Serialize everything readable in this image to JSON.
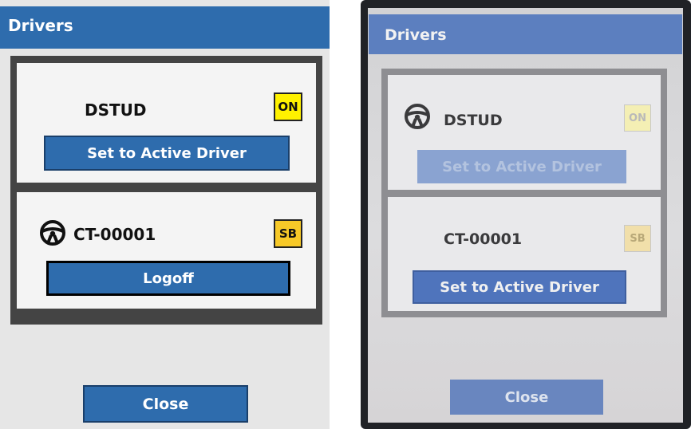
{
  "left_screen": {
    "title": "Drivers",
    "drivers": [
      {
        "name": "DSTUD",
        "status": "ON",
        "status_color": "#fff200",
        "is_active": false,
        "button_label": "Set to Active Driver"
      },
      {
        "name": "CT-00001",
        "status": "SB",
        "status_color": "#f7c928",
        "is_active": true,
        "active_icon": "steering-wheel-icon",
        "button_label": "Logoff"
      }
    ],
    "close_label": "Close"
  },
  "right_screen": {
    "title": "Drivers",
    "drivers": [
      {
        "name": "DSTUD",
        "status": "ON",
        "status_color": "#f4efb4",
        "is_active": true,
        "active_icon": "steering-wheel-icon",
        "button_label": "Set to Active Driver",
        "button_disabled": true
      },
      {
        "name": "CT-00001",
        "status": "SB",
        "status_color": "#f1dfaa",
        "is_active": false,
        "button_label": "Set to Active Driver",
        "button_disabled": false
      }
    ],
    "close_label": "Close"
  },
  "colors": {
    "titlebar": "#2e6cad",
    "button": "#2e6cad"
  }
}
